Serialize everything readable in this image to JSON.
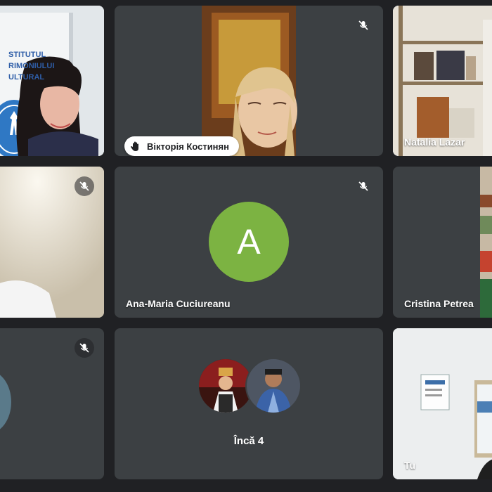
{
  "participants": {
    "p1": {
      "banner_lines": [
        "STITUTUL",
        "RIMONIULUI",
        "ULTURAL"
      ]
    },
    "p2": {
      "name": "Вікторія Костинян",
      "hand_icon": "raised-hand-icon",
      "muted": true
    },
    "p3": {
      "name": "Natalia Lazar",
      "active_speaker": true
    },
    "p4": {
      "muted": true
    },
    "p5": {
      "name": "Ana-Maria Cuciureanu",
      "initial": "A",
      "avatar_color": "#7cb342",
      "muted": true
    },
    "p6": {
      "name": "Cristina Petrea"
    },
    "p7": {
      "muted": true
    },
    "p8": {
      "more_label": "Încă 4"
    },
    "p9": {
      "name": "Tu"
    }
  },
  "colors": {
    "background": "#202124",
    "tile": "#3c4043",
    "active_outline": "#8ab4f8"
  }
}
